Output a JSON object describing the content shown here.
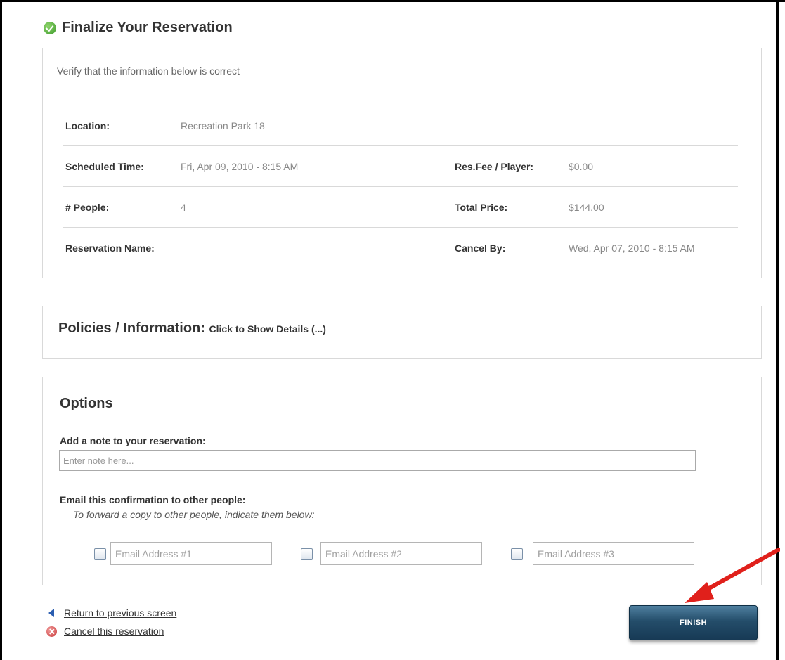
{
  "page": {
    "title": "Finalize Your Reservation"
  },
  "verify": {
    "instruction": "Verify that the information below is correct",
    "rows": [
      [
        {
          "label": "Location:",
          "value": "Recreation Park 18"
        }
      ],
      [
        {
          "label": "Scheduled Time:",
          "value": "Fri, Apr 09, 2010 - 8:15 AM"
        },
        {
          "label": "Res.Fee / Player:",
          "value": "$0.00"
        }
      ],
      [
        {
          "label": "# People:",
          "value": "4"
        },
        {
          "label": "Total Price:",
          "value": "$144.00"
        }
      ],
      [
        {
          "label": "Reservation Name:",
          "value": ""
        },
        {
          "label": "Cancel By:",
          "value": "Wed, Apr 07, 2010 - 8:15 AM"
        }
      ]
    ]
  },
  "policies": {
    "heading": "Policies / Information:",
    "link": "Click to Show Details (...)"
  },
  "options": {
    "heading": "Options",
    "note_label": "Add a note to your reservation:",
    "note_placeholder": "Enter note here...",
    "email_label": "Email this confirmation to other people:",
    "email_instruction": "To forward a copy to other people, indicate them below:",
    "emails": [
      {
        "placeholder": "Email Address #1",
        "checked": false
      },
      {
        "placeholder": "Email Address #2",
        "checked": false
      },
      {
        "placeholder": "Email Address #3",
        "checked": false
      }
    ]
  },
  "links": {
    "return": "Return to previous screen",
    "cancel": "Cancel this reservation"
  },
  "actions": {
    "finish": "FINISH"
  },
  "colors": {
    "annotation_arrow": "#e0201b",
    "finish_button": "#244d6a",
    "success_icon": "#3c9a2b",
    "cancel_icon": "#c93a3a"
  }
}
